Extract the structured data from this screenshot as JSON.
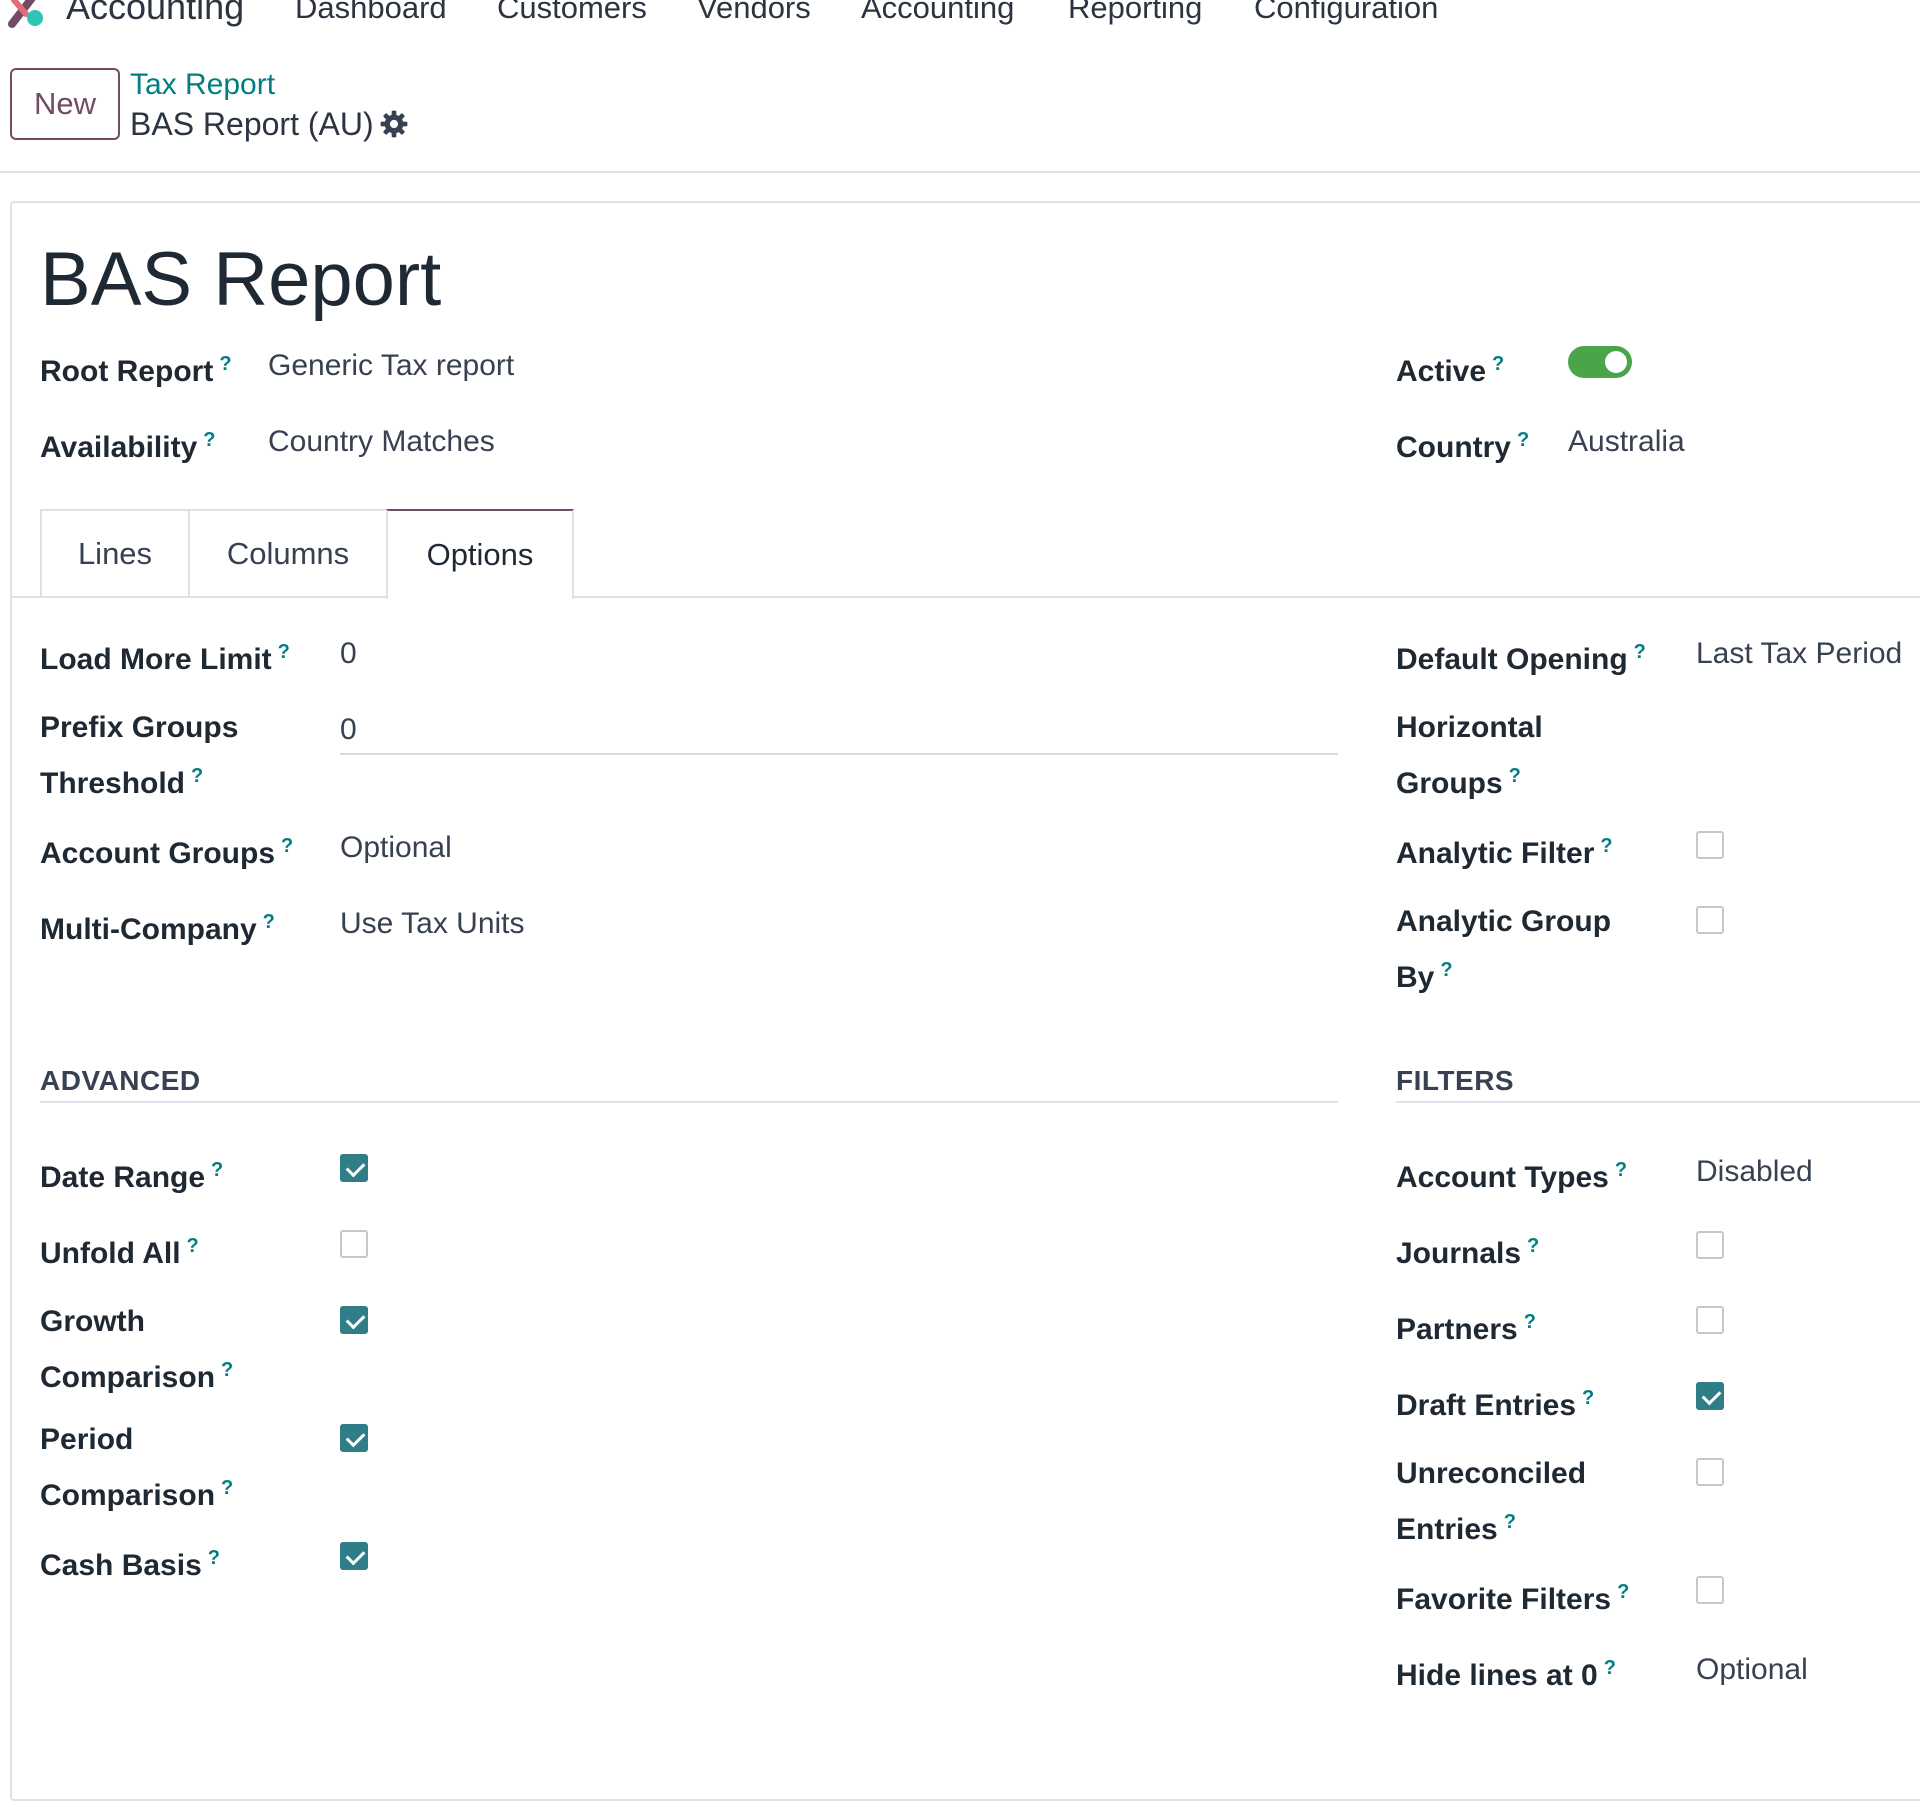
{
  "nav": {
    "app_name": "Accounting",
    "items": [
      "Dashboard",
      "Customers",
      "Vendors",
      "Accounting",
      "Reporting",
      "Configuration"
    ]
  },
  "control_panel": {
    "new_label": "New",
    "breadcrumb_parent": "Tax Report",
    "breadcrumb_current": "BAS Report (AU)"
  },
  "form": {
    "title": "BAS Report",
    "root_report": {
      "label": "Root Report",
      "value": "Generic Tax report"
    },
    "availability": {
      "label": "Availability",
      "value": "Country Matches"
    },
    "active": {
      "label": "Active",
      "value": true
    },
    "country": {
      "label": "Country",
      "value": "Australia"
    }
  },
  "tabs": [
    "Lines",
    "Columns",
    "Options"
  ],
  "options_left": {
    "load_more_limit": {
      "label": "Load More Limit",
      "value": "0"
    },
    "prefix_groups_threshold": {
      "label1": "Prefix Groups",
      "label2": "Threshold",
      "value": "0"
    },
    "account_groups": {
      "label": "Account Groups",
      "value": "Optional"
    },
    "multi_company": {
      "label": "Multi-Company",
      "value": "Use Tax Units"
    }
  },
  "options_right": {
    "default_opening": {
      "label": "Default Opening",
      "value": "Last Tax Period"
    },
    "horizontal_groups": {
      "label1": "Horizontal",
      "label2": "Groups"
    },
    "analytic_filter": {
      "label": "Analytic Filter",
      "checked": false
    },
    "analytic_group_by": {
      "label1": "Analytic Group",
      "label2": "By",
      "checked": false
    }
  },
  "advanced": {
    "title": "ADVANCED",
    "date_range": {
      "label": "Date Range",
      "checked": true
    },
    "unfold_all": {
      "label": "Unfold All",
      "checked": false
    },
    "growth_comparison": {
      "label1": "Growth",
      "label2": "Comparison",
      "checked": true
    },
    "period_comparison": {
      "label1": "Period",
      "label2": "Comparison",
      "checked": true
    },
    "cash_basis": {
      "label": "Cash Basis",
      "checked": true
    }
  },
  "filters": {
    "title": "FILTERS",
    "account_types": {
      "label": "Account Types",
      "value": "Disabled"
    },
    "journals": {
      "label": "Journals",
      "checked": false
    },
    "partners": {
      "label": "Partners",
      "checked": false
    },
    "draft_entries": {
      "label": "Draft Entries",
      "checked": true
    },
    "unreconciled_entries": {
      "label1": "Unreconciled",
      "label2": "Entries",
      "checked": false
    },
    "favorite_filters": {
      "label": "Favorite Filters",
      "checked": false
    },
    "hide_lines_at_0": {
      "label": "Hide lines at 0",
      "value": "Optional"
    }
  },
  "help_marker": "?",
  "colors": {
    "brand": "#714b67",
    "link": "#017e84",
    "toggle_on": "#4aa54a",
    "checkbox_on": "#2f7d86"
  }
}
